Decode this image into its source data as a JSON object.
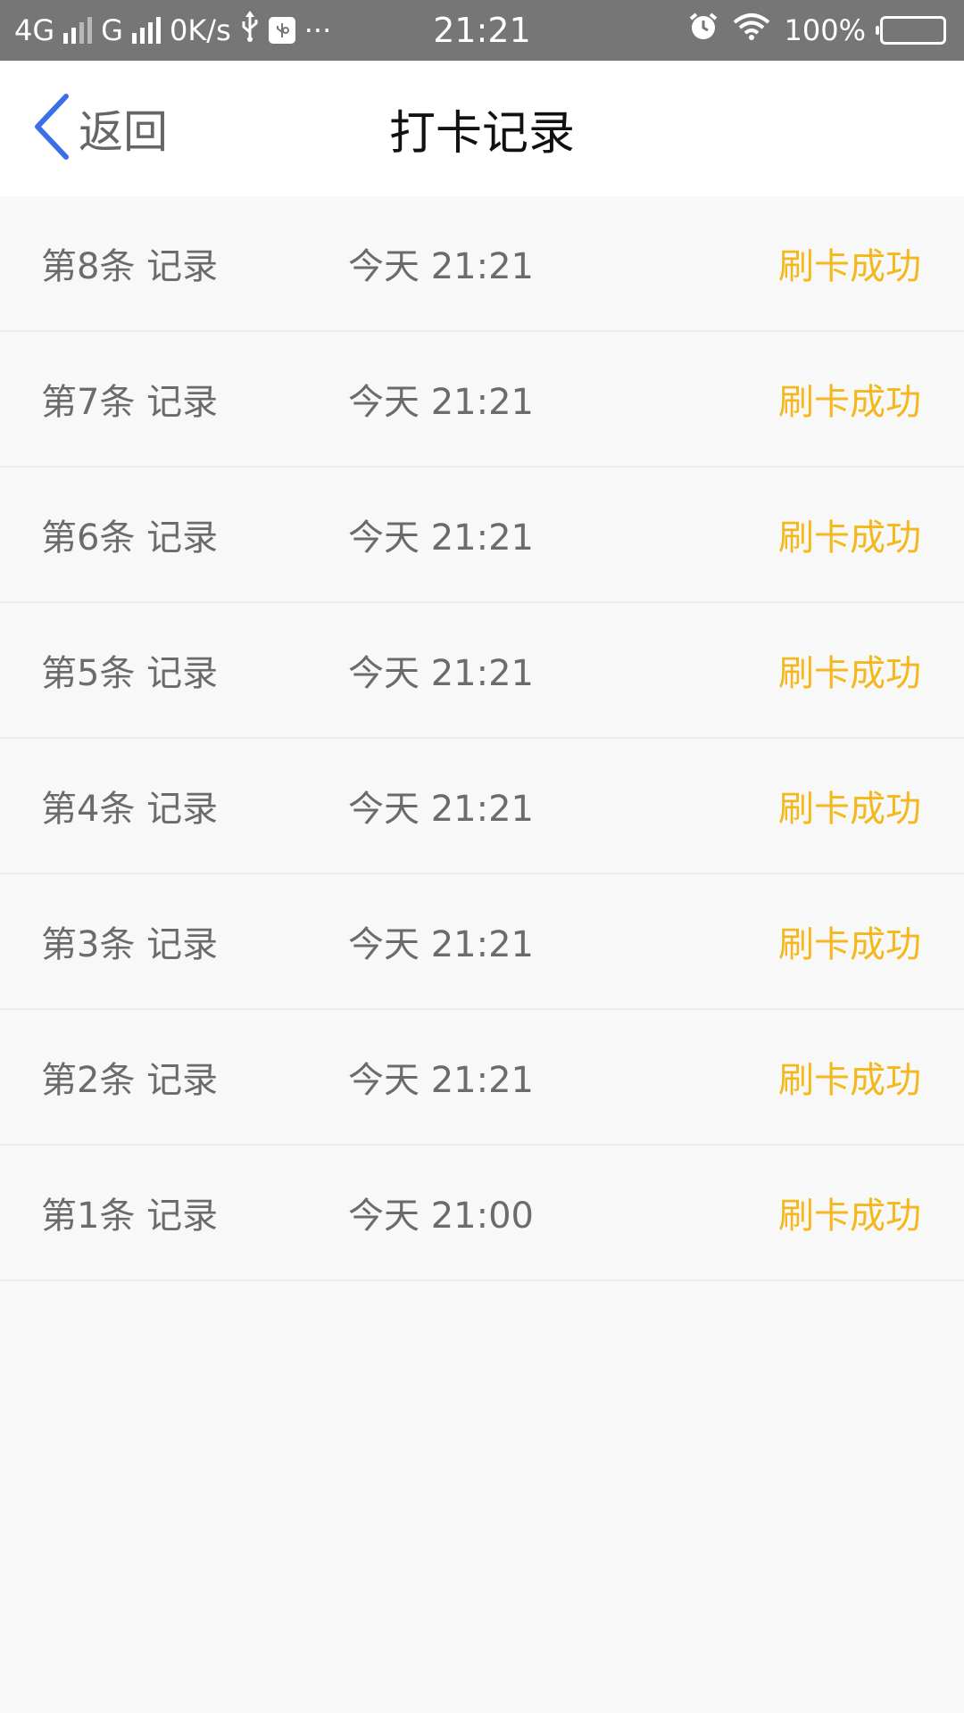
{
  "status_bar": {
    "network_1": "4G",
    "network_2": "G",
    "speed": "0K/s",
    "more": "···",
    "time": "21:21",
    "battery": "100%",
    "icons": [
      "signal-icon",
      "usb-icon",
      "usb-debug-icon",
      "alarm-icon",
      "wifi-icon",
      "battery-icon"
    ]
  },
  "nav": {
    "back_label": "返回",
    "title": "打卡记录",
    "back_icon": "chevron-left-icon",
    "accent_color": "#3b6fe8"
  },
  "records": [
    {
      "label": "第8条 记录",
      "time": "今天 21:21",
      "status": "刷卡成功"
    },
    {
      "label": "第7条 记录",
      "time": "今天 21:21",
      "status": "刷卡成功"
    },
    {
      "label": "第6条 记录",
      "time": "今天 21:21",
      "status": "刷卡成功"
    },
    {
      "label": "第5条 记录",
      "time": "今天 21:21",
      "status": "刷卡成功"
    },
    {
      "label": "第4条 记录",
      "time": "今天 21:21",
      "status": "刷卡成功"
    },
    {
      "label": "第3条 记录",
      "time": "今天 21:21",
      "status": "刷卡成功"
    },
    {
      "label": "第2条 记录",
      "time": "今天 21:21",
      "status": "刷卡成功"
    },
    {
      "label": "第1条 记录",
      "time": "今天 21:00",
      "status": "刷卡成功"
    }
  ],
  "colors": {
    "status_success": "#f5b81c",
    "text_secondary": "#6b6b6b",
    "status_bar_bg": "#767676"
  }
}
